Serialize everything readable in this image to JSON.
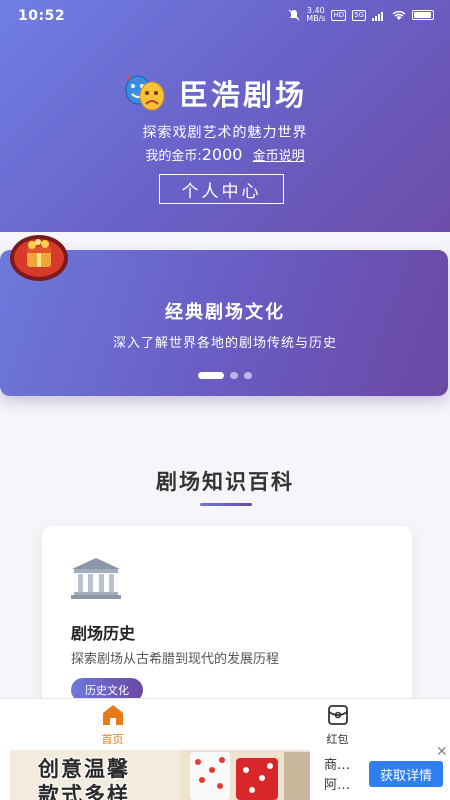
{
  "status_bar": {
    "time": "10:52",
    "speed_value": "3.40",
    "speed_unit": "MB/s",
    "hd": "HD",
    "network": "5G"
  },
  "header": {
    "title": "臣浩剧场",
    "tagline": "探索戏剧艺术的魅力世界",
    "coins_label": "我的金币:",
    "coins_value": "2000",
    "coins_link": "金币说明",
    "profile_button": "个人中心"
  },
  "carousel": {
    "title": "经典剧场文化",
    "subtitle": "深入了解世界各地的剧场传统与历史",
    "active_index": 0,
    "count": 3
  },
  "section": {
    "title": "剧场知识百科"
  },
  "cards": [
    {
      "icon": "museum-icon",
      "title": "剧场历史",
      "description": "探索剧场从古希腊到现代的发展历程",
      "tag": "历史文化"
    }
  ],
  "bottom_nav": [
    {
      "label": "首页",
      "icon": "home-icon",
      "active": true
    },
    {
      "label": "红包",
      "icon": "red-packet-icon",
      "active": false
    }
  ],
  "ad": {
    "headline_line1": "创意温馨",
    "headline_line2": "款式多样",
    "meta_line1": "商…",
    "meta_line2": "阿…",
    "cta": "获取详情",
    "close": "✕"
  },
  "colors": {
    "brand_start": "#6f7fe3",
    "brand_end": "#6c4ea8",
    "active_nav": "#e87a1a",
    "ad_button": "#2f7ff0"
  }
}
